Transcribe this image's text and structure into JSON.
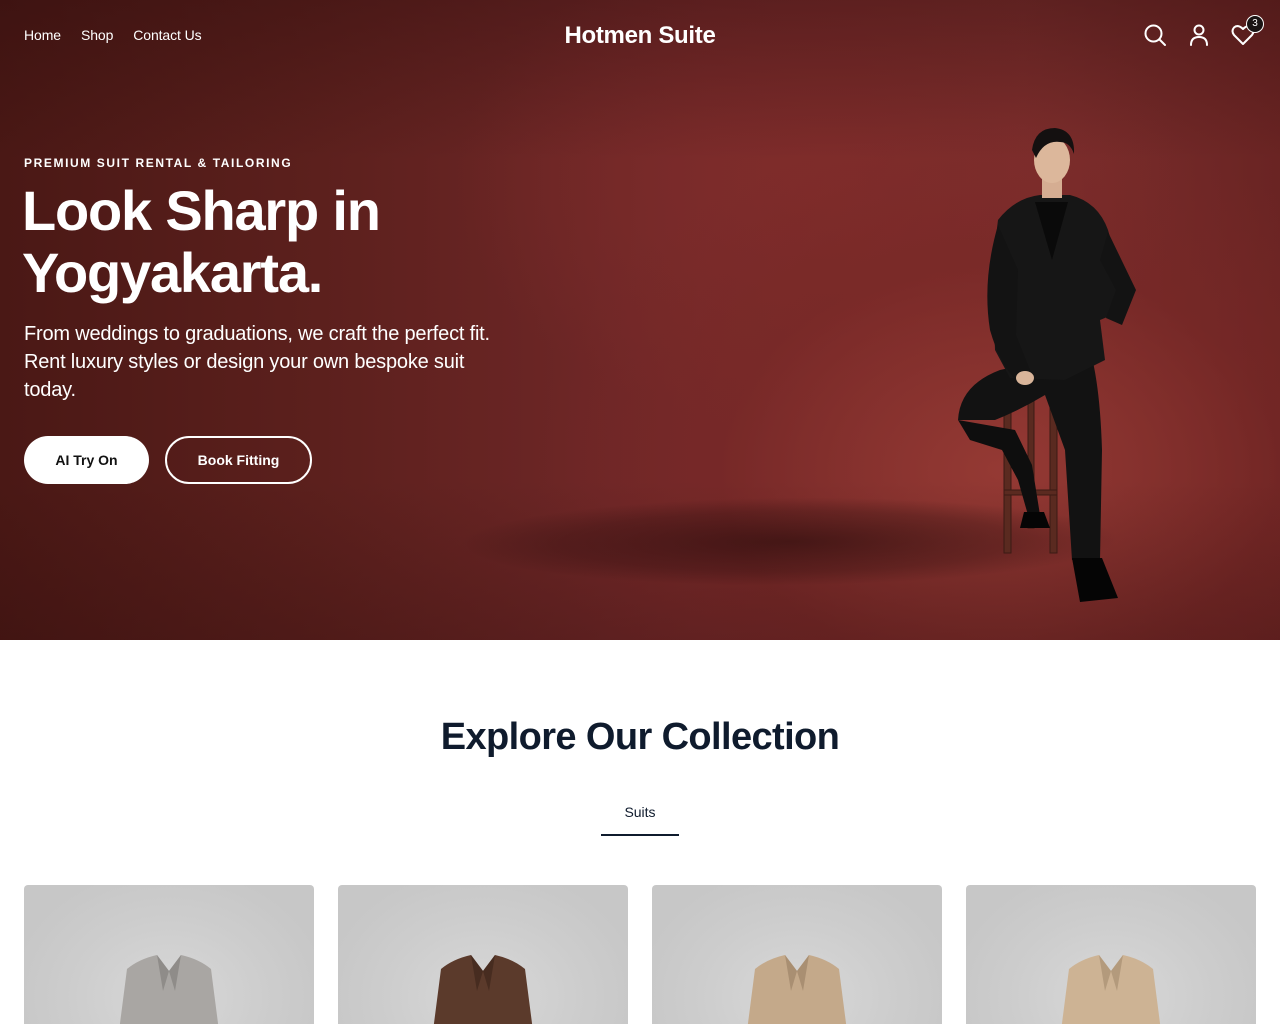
{
  "nav": {
    "links": [
      "Home",
      "Shop",
      "Contact Us"
    ],
    "brand": "Hotmen Suite",
    "icons": [
      "search-icon",
      "user-icon",
      "heart-icon"
    ],
    "wishlist_count": "3"
  },
  "hero": {
    "eyebrow": "PREMIUM SUIT RENTAL & TAILORING",
    "headline": "Look Sharp in Yogyakarta.",
    "subtext": "From weddings to graduations, we craft the perfect fit. Rent luxury styles or design your own bespoke suit today.",
    "primary_button": "AI Try On",
    "secondary_button": "Book Fitting"
  },
  "collection": {
    "title": "Explore Our Collection",
    "tabs": [
      "Suits"
    ],
    "cards": [
      {
        "jacket_color": "#a9a6a3",
        "lapel_color": "#8f8c89"
      },
      {
        "jacket_color": "#5b3a2b",
        "lapel_color": "#472c20"
      },
      {
        "jacket_color": "#c4a98a",
        "lapel_color": "#a98f72"
      },
      {
        "jacket_color": "#cdb394",
        "lapel_color": "#b39a7c"
      }
    ]
  },
  "colors": {
    "hero_bg": "#6e2625",
    "text_dark": "#0f1b2d",
    "white": "#ffffff"
  }
}
